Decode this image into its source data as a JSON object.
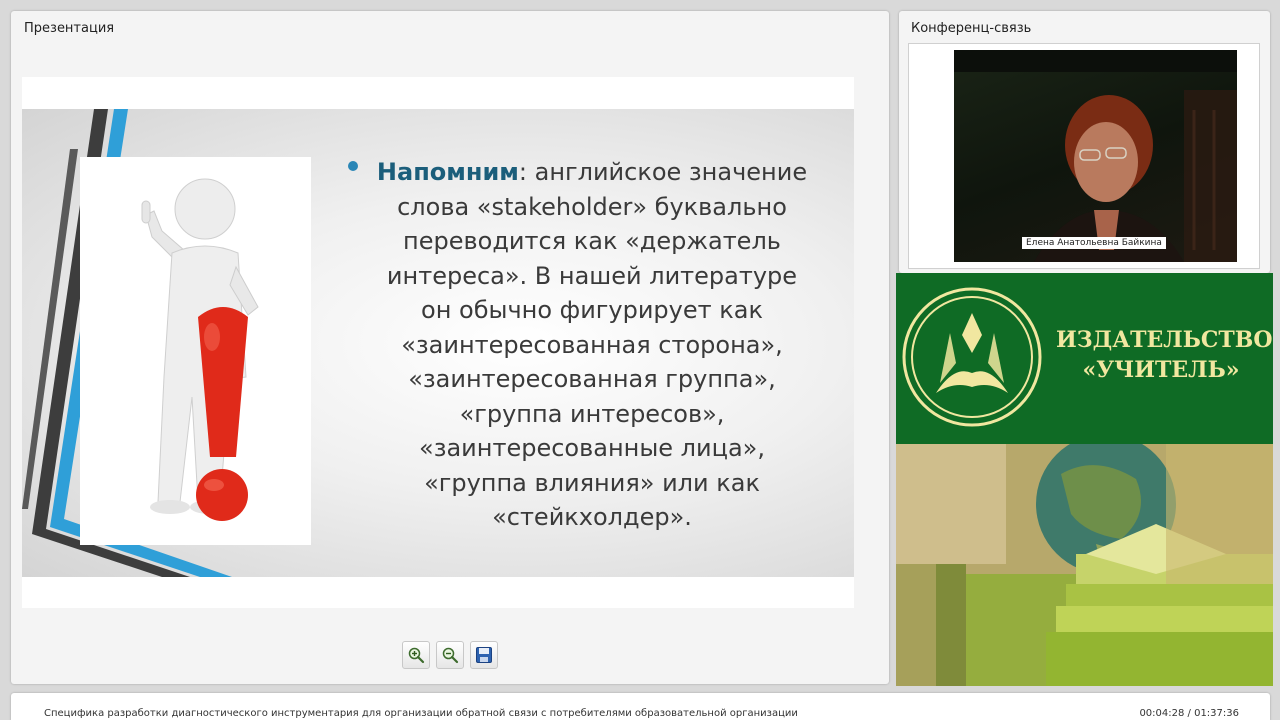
{
  "presentation": {
    "panel_title": "Презентация",
    "slide": {
      "lead": "Напомним",
      "lines": [
        ": английское значение",
        "слова «stakeholder» буквально",
        "переводится как «держатель",
        "интереса». В нашей литературе",
        "он обычно фигурирует как",
        "«заинтересованная сторона»,",
        "«заинтересованная группа»,",
        "«группа интересов»,",
        "«заинтересованные лица»,",
        "«группа влияния» или как",
        "«стейкхолдер»."
      ]
    },
    "toolbar": {
      "zoom_in_icon": "zoom-in-icon",
      "zoom_out_icon": "zoom-out-icon",
      "save_icon": "save-icon"
    }
  },
  "conference": {
    "panel_title": "Конференц-связь",
    "speaker_name": "Елена Анатольевна Байкина"
  },
  "ad": {
    "line1": "ИЗДАТЕЛЬСТВО",
    "line2": "«УЧИТЕЛЬ»"
  },
  "footer": {
    "title": "Специфика разработки диагностического инструментария для организации обратной связи с потребителями образовательной организации",
    "time": "00:04:28 / 01:37:36"
  },
  "colors": {
    "accent_blue": "#2a86b6",
    "lead_text": "#1b5e7b",
    "exclamation_red": "#e02a1a",
    "publisher_green": "#0f6b25",
    "publisher_gold": "#f1e7a0"
  }
}
